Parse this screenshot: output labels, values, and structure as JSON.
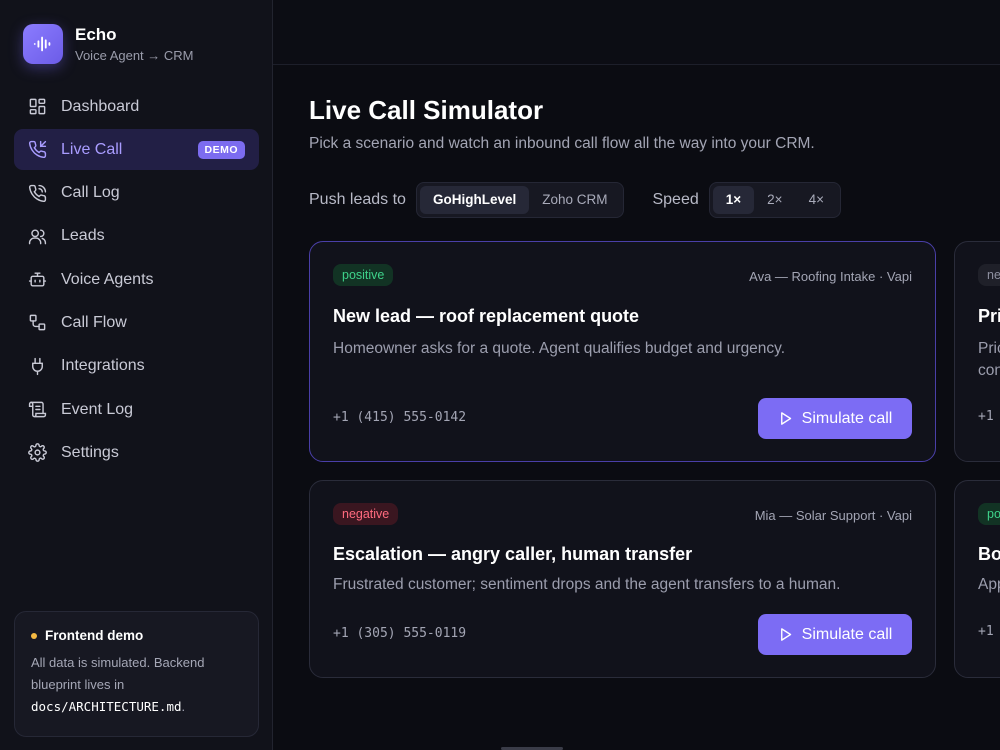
{
  "brand": {
    "title": "Echo",
    "subtitle": "Voice Agent → CRM"
  },
  "nav": [
    {
      "label": "Dashboard",
      "icon": "dashboard-icon"
    },
    {
      "label": "Live Call",
      "icon": "phone-incoming-icon",
      "badge": "DEMO",
      "active": true
    },
    {
      "label": "Call Log",
      "icon": "phone-icon"
    },
    {
      "label": "Leads",
      "icon": "users-icon"
    },
    {
      "label": "Voice Agents",
      "icon": "bot-icon"
    },
    {
      "label": "Call Flow",
      "icon": "flow-icon"
    },
    {
      "label": "Integrations",
      "icon": "plug-icon"
    },
    {
      "label": "Event Log",
      "icon": "scroll-icon"
    },
    {
      "label": "Settings",
      "icon": "gear-icon"
    }
  ],
  "demo_box": {
    "title": "Frontend demo",
    "text": "All data is simulated. Backend blueprint lives in",
    "code": "docs/ARCHITECTURE.md",
    "suffix": "."
  },
  "page": {
    "title": "Live Call Simulator",
    "subtitle": "Pick a scenario and watch an inbound call flow all the way into your CRM."
  },
  "controls": {
    "push_label": "Push leads to",
    "crm_options": [
      "GoHighLevel",
      "Zoho CRM"
    ],
    "crm_selected": "GoHighLevel",
    "speed_label": "Speed",
    "speed_options": [
      "1×",
      "2×",
      "4×"
    ],
    "speed_selected": "1×"
  },
  "scenarios": [
    {
      "sentiment": "positive",
      "agent": "Ava — Roofing Intake · Vapi",
      "title": "New lead — roof replacement quote",
      "desc": "Homeowner asks for a quote. Agent qualifies budget and urgency.",
      "phone": "+1 (415) 555-0142",
      "button": "Simulate call"
    },
    {
      "sentiment": "negative",
      "agent": "Mia — Solar Support · Vapi",
      "title": "Escalation — angry caller, human transfer",
      "desc": "Frustrated customer; sentiment drops and the agent transfers to a human.",
      "phone": "+1 (305) 555-0119",
      "button": "Simulate call"
    }
  ],
  "peek_cards": [
    {
      "badge": "ne",
      "title": "Pri",
      "desc1": "Pric",
      "desc2": "con",
      "phone": "+1"
    },
    {
      "badge": "po",
      "title": "Bo",
      "desc1": "App",
      "phone": "+1"
    }
  ],
  "colors": {
    "accent": "#7c6cf4",
    "positive": "#3ed28a",
    "negative": "#ff6b7f",
    "demo_dot": "#f5b942"
  }
}
